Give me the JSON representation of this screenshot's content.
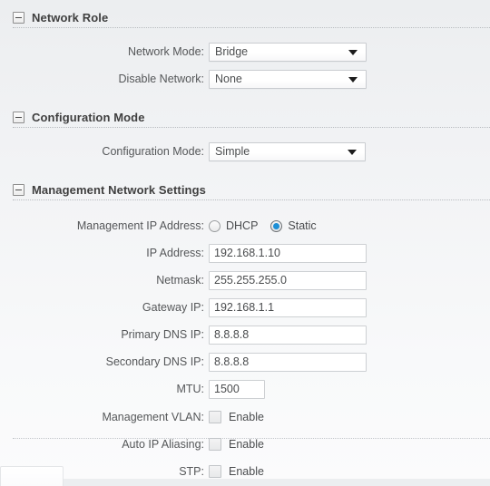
{
  "sections": [
    {
      "id": "network-role",
      "title": "Network Role",
      "rows": [
        {
          "label": "Network Mode:",
          "value": "Bridge"
        },
        {
          "label": "Disable Network:",
          "value": "None"
        }
      ]
    },
    {
      "id": "configuration-mode",
      "title": "Configuration Mode",
      "rows": [
        {
          "label": "Configuration Mode:",
          "value": "Simple"
        }
      ]
    },
    {
      "id": "management-network-settings",
      "title": "Management Network Settings",
      "rows": [
        {
          "label": "Management IP Address:",
          "option_dhcp": "DHCP",
          "option_static": "Static",
          "selected": "Static"
        },
        {
          "label": "IP Address:",
          "value": "192.168.1.10"
        },
        {
          "label": "Netmask:",
          "value": "255.255.255.0"
        },
        {
          "label": "Gateway IP:",
          "value": "192.168.1.1"
        },
        {
          "label": "Primary DNS IP:",
          "value": "8.8.8.8"
        },
        {
          "label": "Secondary DNS IP:",
          "value": "8.8.8.8"
        },
        {
          "label": "MTU:",
          "value": "1500"
        },
        {
          "label": "Management VLAN:",
          "checkbox_label": "Enable",
          "checked": false
        },
        {
          "label": "Auto IP Aliasing:",
          "checkbox_label": "Enable",
          "checked": false
        },
        {
          "label": "STP:",
          "checkbox_label": "Enable",
          "checked": false
        }
      ]
    }
  ],
  "colors": {
    "accent": "#1d8fd6",
    "header_text": "#3f3f3f",
    "label_text": "#555759",
    "field_border": "#cdd0d3"
  }
}
